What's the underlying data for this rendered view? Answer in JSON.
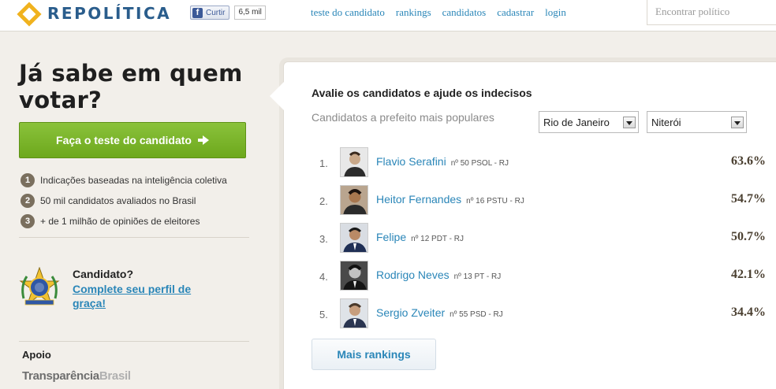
{
  "header": {
    "brand": "REPOLÍTICA",
    "facebook": {
      "like_label": "Curtir",
      "count": "6,5 mil"
    },
    "nav": [
      "teste do candidato",
      "rankings",
      "candidatos",
      "cadastrar",
      "login"
    ],
    "search_placeholder": "Encontrar político"
  },
  "left": {
    "hero": "Já sabe em quem votar?",
    "cta_label": "Faça o teste do candidato",
    "features": [
      {
        "num": "1",
        "text": "Indicações baseadas na inteligência coletiva"
      },
      {
        "num": "2",
        "text": "50 mil candidatos avaliados no Brasil"
      },
      {
        "num": "3",
        "text": "+ de 1 milhão de opiniões de eleitores"
      }
    ],
    "candidate_title": "Candidato?",
    "candidate_link": "Complete seu perfil de graça!",
    "support_label": "Apoio",
    "support_brand_part1": "Transparência",
    "support_brand_part2": "Brasil"
  },
  "panel": {
    "title": "Avalie os candidatos e ajude os indecisos",
    "subtitle": "Candidatos a prefeito mais populares",
    "state_select": "Rio de Janeiro",
    "city_select": "Niterói",
    "candidates": [
      {
        "pos": "1.",
        "name": "Flavio Serafini",
        "party": "nº 50 PSOL - RJ",
        "pct": "63.6%"
      },
      {
        "pos": "2.",
        "name": "Heitor Fernandes",
        "party": "nº 16 PSTU - RJ",
        "pct": "54.7%"
      },
      {
        "pos": "3.",
        "name": "Felipe",
        "party": "nº 12 PDT - RJ",
        "pct": "50.7%"
      },
      {
        "pos": "4.",
        "name": "Rodrigo Neves",
        "party": "nº 13 PT - RJ",
        "pct": "42.1%"
      },
      {
        "pos": "5.",
        "name": "Sergio Zveiter",
        "party": "nº 55 PSD - RJ",
        "pct": "34.4%"
      }
    ],
    "more_label": "Mais rankings"
  },
  "colors": {
    "brand_blue": "#2a5d8c",
    "logo_yellow": "#f0b21e",
    "link_blue": "#2a86b8",
    "cta_green": "#7bb52b"
  }
}
